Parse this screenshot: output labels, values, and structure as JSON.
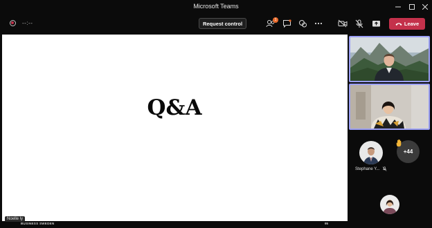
{
  "window": {
    "title": "Microsoft Teams"
  },
  "toolbar": {
    "timer": "--:--",
    "request_control_label": "Request control",
    "participants_badge": "1",
    "leave_label": "Leave"
  },
  "slide": {
    "title": "Q&A",
    "footer_brand": "BUSINESS SWEDEN",
    "footer_page": "95"
  },
  "presenter": {
    "name": "Noelle ly"
  },
  "participants": [
    {
      "name": "Stephane Y..."
    }
  ],
  "overflow_count": "+44",
  "colors": {
    "accent_border": "#9b9ff5",
    "leave_red": "#c4314b",
    "badge_orange": "#e86a2b",
    "raised_hand": "#f2b538"
  },
  "icons": [
    "record-icon",
    "participants-icon",
    "chat-icon",
    "reactions-icon",
    "more-options-icon",
    "camera-off-icon",
    "mic-muted-icon",
    "share-screen-icon",
    "phone-icon",
    "raised-hand-icon"
  ]
}
